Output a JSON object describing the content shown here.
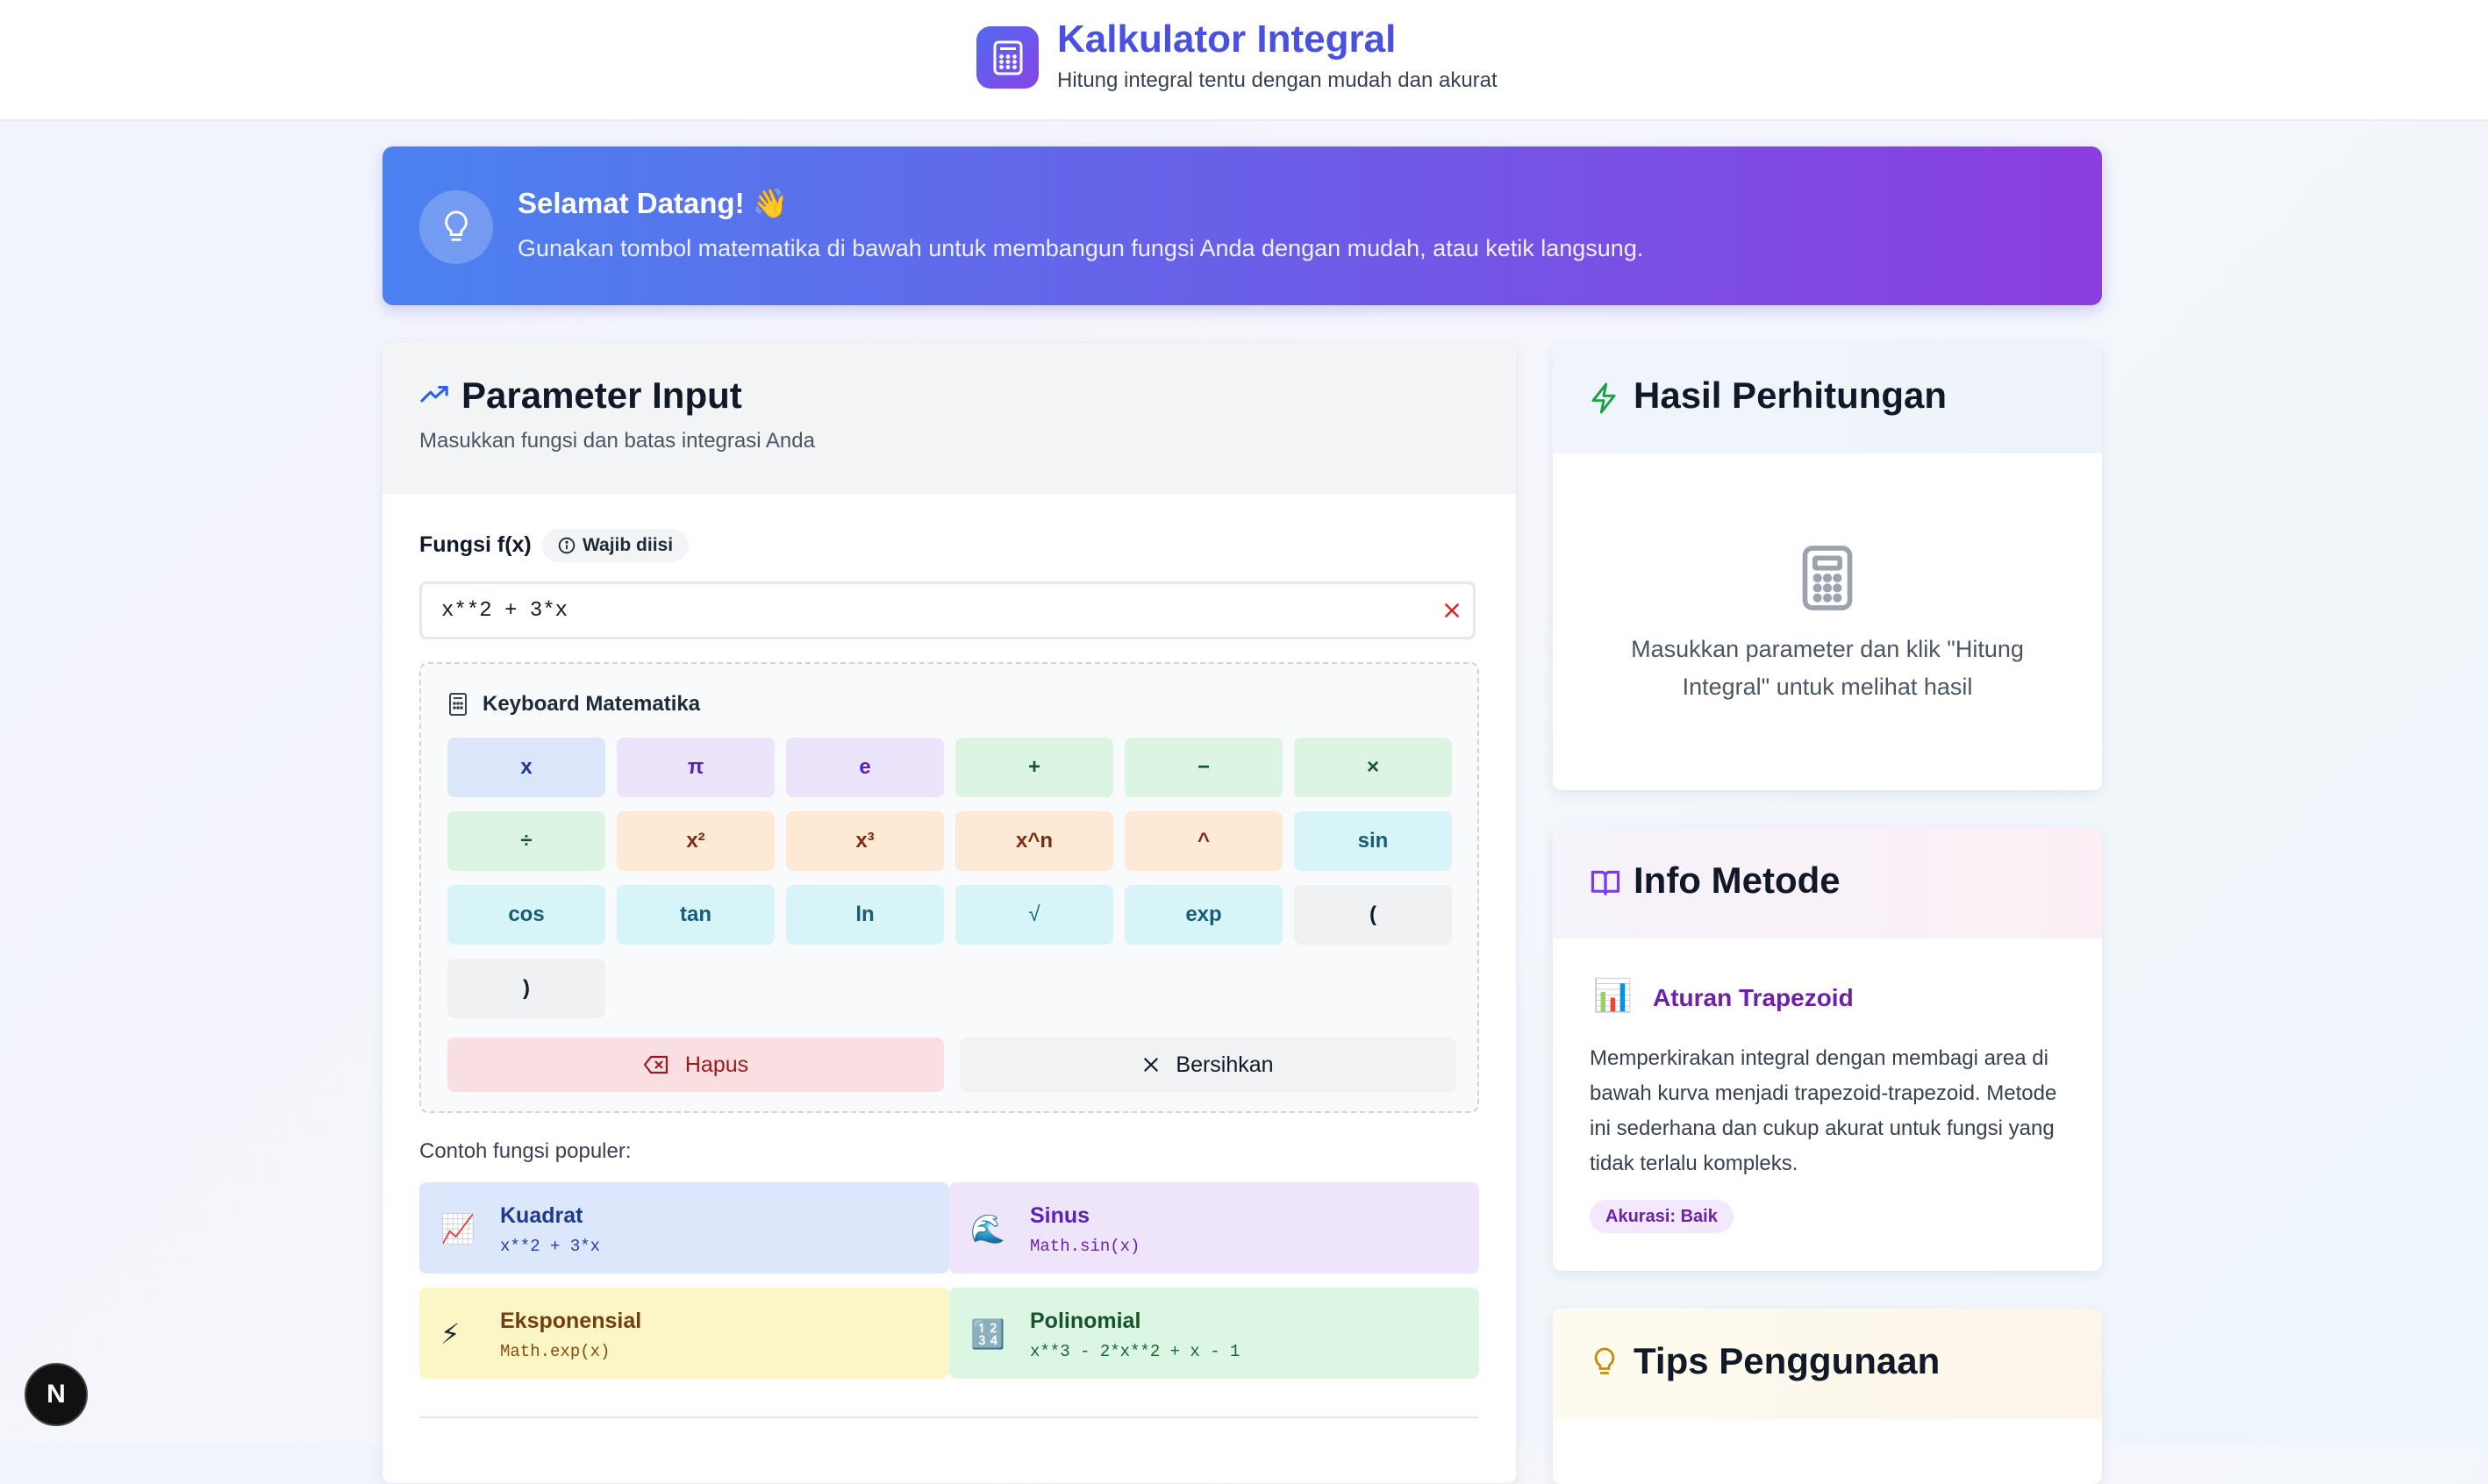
{
  "header": {
    "title": "Kalkulator Integral",
    "subtitle": "Hitung integral tentu dengan mudah dan akurat",
    "logo_icon": "calculator-icon"
  },
  "banner": {
    "title": "Selamat Datang! 👋",
    "text": "Gunakan tombol matematika di bawah untuk membangun fungsi Anda dengan mudah, atau ketik langsung.",
    "icon": "lightbulb-icon"
  },
  "input_card": {
    "title": "Parameter Input",
    "description": "Masukkan fungsi dan batas integrasi Anda",
    "function_label": "Fungsi f(x)",
    "required_badge": "Wajib diisi",
    "function_value": "x**2 + 3*x",
    "keyboard": {
      "title": "Keyboard Matematika",
      "keys": [
        "x",
        "π",
        "e",
        "+",
        "−",
        "×",
        "÷",
        "x²",
        "x³",
        "x^n",
        "^",
        "sin",
        "cos",
        "tan",
        "ln",
        "√",
        "exp",
        "(",
        ")"
      ],
      "delete_label": "Hapus",
      "clear_label": "Bersihkan"
    },
    "examples_label": "Contoh fungsi populer:",
    "examples": [
      {
        "name": "Kuadrat",
        "formula": "x**2 + 3*x",
        "icon": "📈"
      },
      {
        "name": "Sinus",
        "formula": "Math.sin(x)",
        "icon": "🌊"
      },
      {
        "name": "Eksponensial",
        "formula": "Math.exp(x)",
        "icon": "⚡"
      },
      {
        "name": "Polinomial",
        "formula": "x**3 - 2*x**2 + x - 1",
        "icon": "🔢"
      }
    ]
  },
  "result_card": {
    "title": "Hasil Perhitungan",
    "placeholder": "Masukkan parameter dan klik \"Hitung Integral\" untuk melihat hasil"
  },
  "info_card": {
    "title": "Info Metode",
    "method_icon": "📊",
    "method_name": "Aturan Trapezoid",
    "method_description": "Memperkirakan integral dengan membagi area di bawah kurva menjadi trapezoid-trapezoid. Metode ini sederhana dan cukup akurat untuk fungsi yang tidak terlalu kompleks.",
    "accuracy": "Akurasi: Baik"
  },
  "tips_card": {
    "title": "Tips Penggunaan"
  },
  "dev_badge": "N"
}
